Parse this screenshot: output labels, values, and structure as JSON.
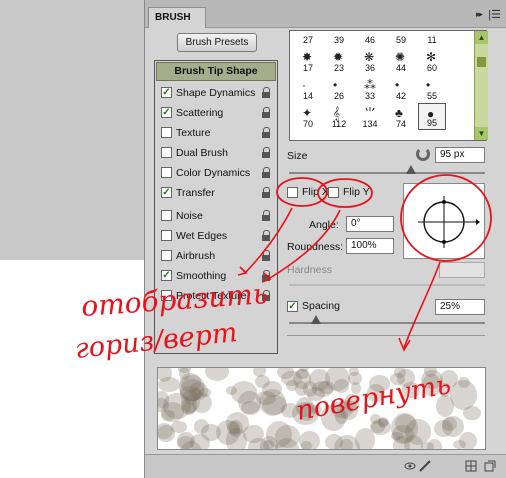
{
  "panel": {
    "tab_label": "BRUSH",
    "collapse_icon": "double-chevron-icon",
    "menu_icon": "panel-menu-icon"
  },
  "presets_button": "Brush Presets",
  "options_list": {
    "header": "Brush Tip Shape",
    "items": [
      {
        "label": "Shape Dynamics",
        "checked": true
      },
      {
        "label": "Scattering",
        "checked": true
      },
      {
        "label": "Texture",
        "checked": false
      },
      {
        "label": "Dual Brush",
        "checked": false
      },
      {
        "label": "Color Dynamics",
        "checked": false
      },
      {
        "label": "Transfer",
        "checked": true
      },
      {
        "label": "Noise",
        "checked": false
      },
      {
        "label": "Wet Edges",
        "checked": false
      },
      {
        "label": "Airbrush",
        "checked": false
      },
      {
        "label": "Smoothing",
        "checked": true
      },
      {
        "label": "Protect Texture",
        "checked": false
      }
    ]
  },
  "brush_tips": {
    "row0": [
      "27",
      "39",
      "46",
      "59",
      "11"
    ],
    "row1": [
      "17",
      "23",
      "36",
      "44",
      "60"
    ],
    "row2": [
      "14",
      "26",
      "33",
      "42",
      "55"
    ],
    "row3": [
      "70",
      "112",
      "134",
      "74",
      "95"
    ],
    "selected": "95"
  },
  "size": {
    "label": "Size",
    "value": "95 px",
    "level": 0.62
  },
  "flip_x": {
    "label": "Flip X",
    "checked": false
  },
  "flip_y": {
    "label": "Flip Y",
    "checked": false
  },
  "angle": {
    "label": "Angle:",
    "value": "0°"
  },
  "roundness": {
    "label": "Roundness:",
    "value": "100%"
  },
  "hardness": {
    "label": "Hardness",
    "value": ""
  },
  "spacing": {
    "label": "Spacing",
    "checked": true,
    "value": "25%",
    "level": 0.14
  },
  "annotations": {
    "left_note_line1": "отобразить",
    "left_note_line2": "гориз/верт",
    "right_note": "повернуть"
  },
  "colors": {
    "annotation": "#e8121b",
    "option_header": "#a5ad8c",
    "scroll": "#a8c56a"
  }
}
